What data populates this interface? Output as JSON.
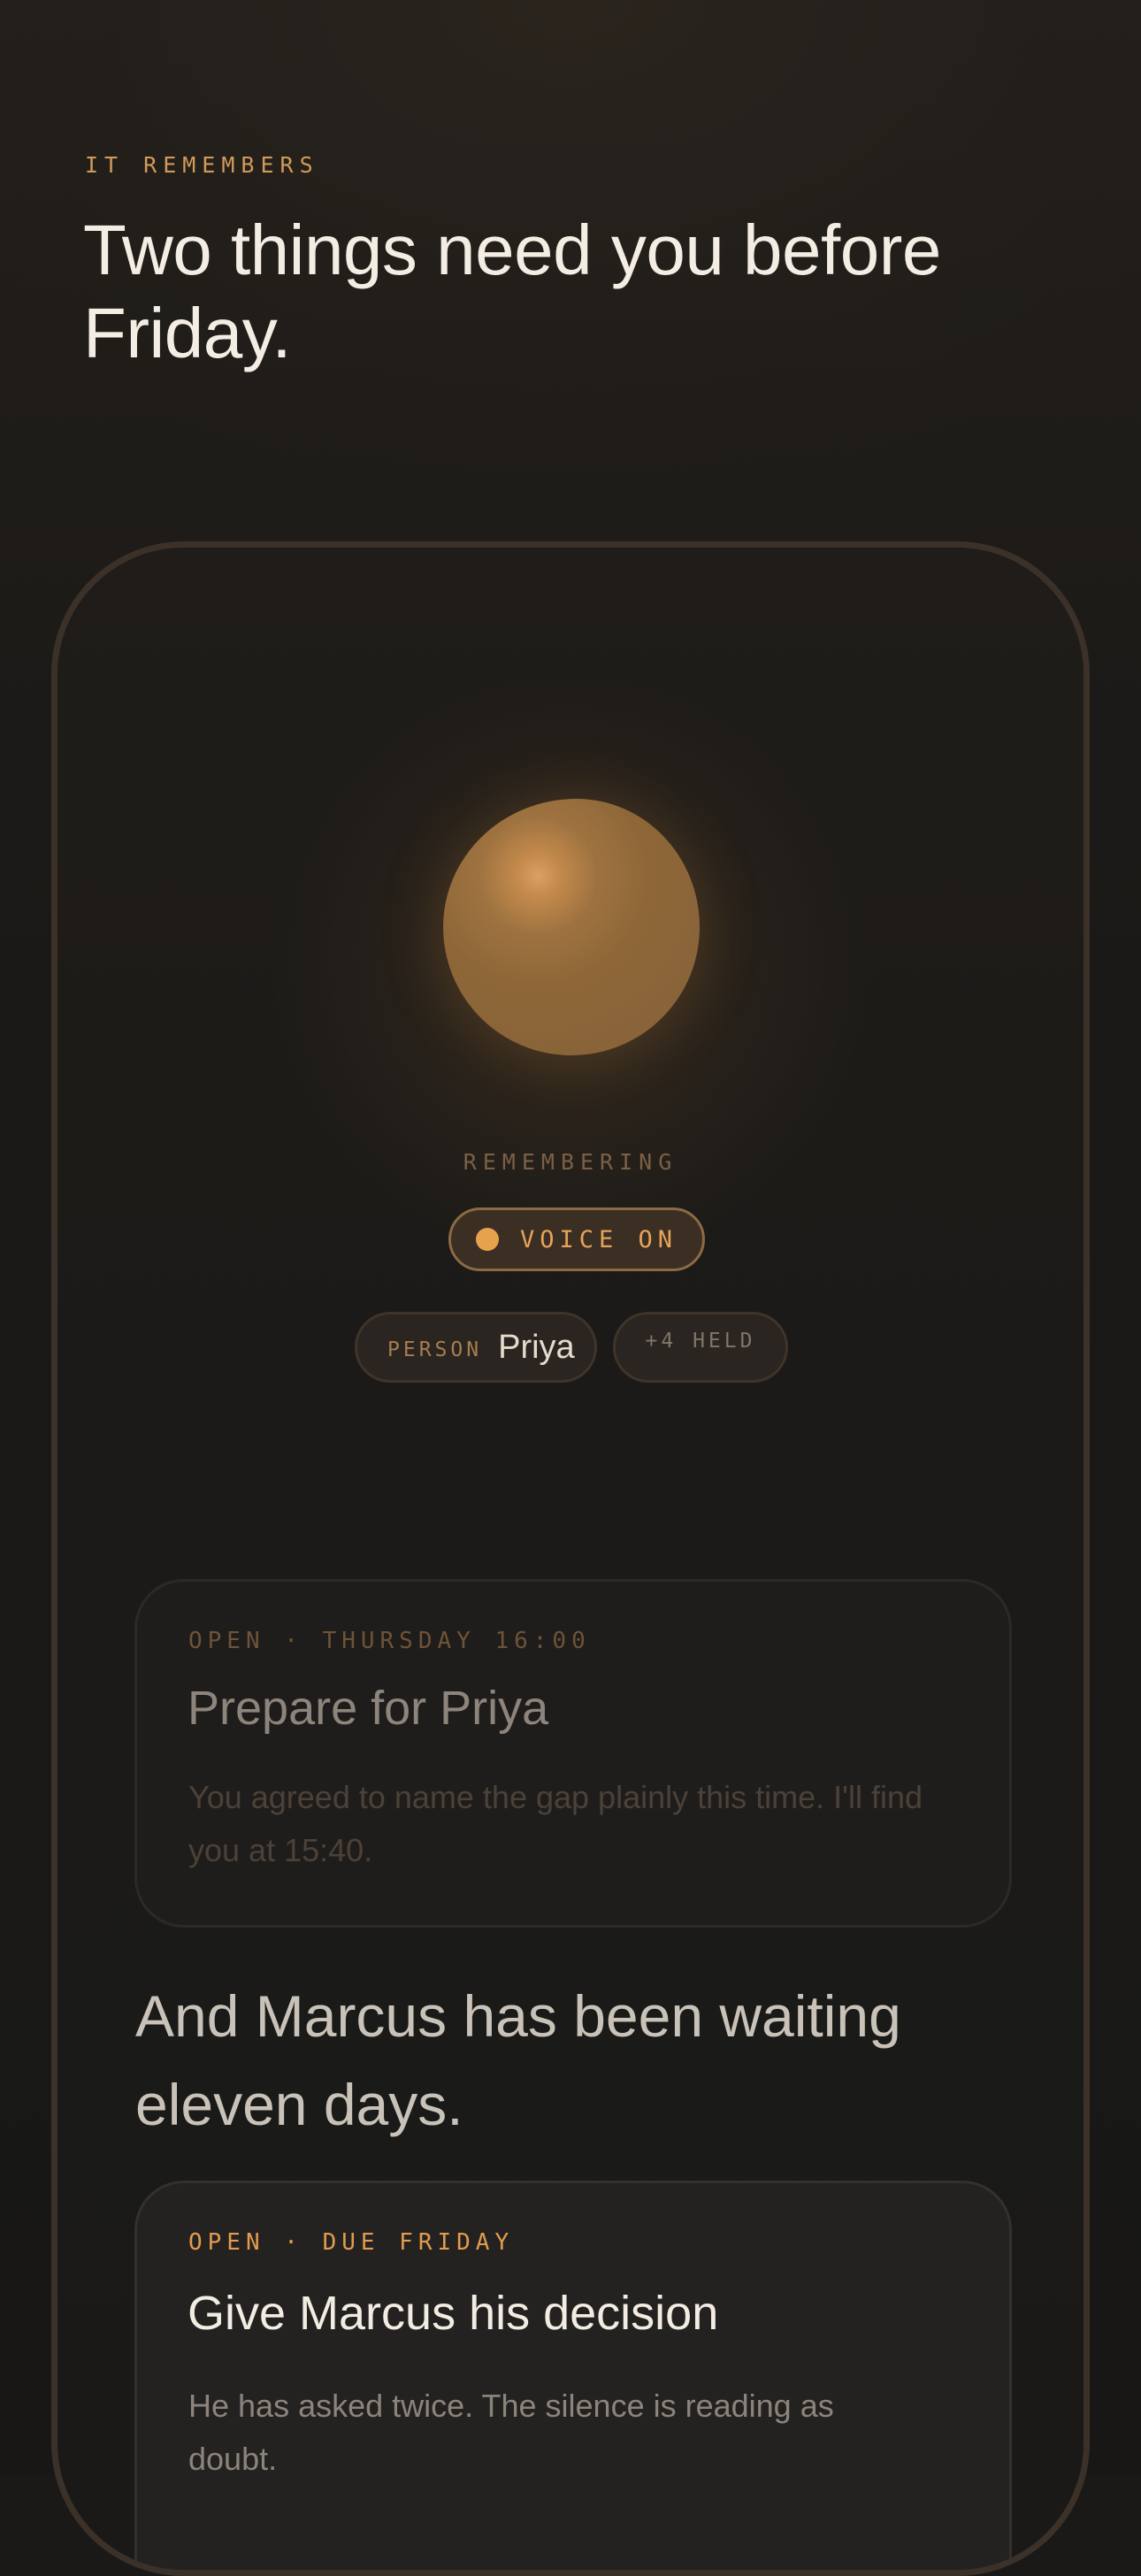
{
  "header": {
    "eyebrow": "IT REMEMBERS",
    "headline": "Two things need you before Friday."
  },
  "assistant": {
    "status": "REMEMBERING",
    "voice_toggle": {
      "label": "VOICE ON",
      "state": "on"
    },
    "context_chips": [
      {
        "kind": "PERSON",
        "value": "Priya"
      },
      {
        "label": "+4 HELD"
      }
    ]
  },
  "tasks": [
    {
      "tag": "OPEN · THURSDAY 16:00",
      "title": "Prepare for Priya",
      "body": "You agreed to name the gap plainly this time. I'll find you at 15:40."
    },
    {
      "tag": "OPEN · DUE FRIDAY",
      "title": "Give Marcus his decision",
      "body": "He has asked twice. The silence is reading as doubt."
    }
  ],
  "interlude": "And Marcus has been waiting eleven days.",
  "colors": {
    "accent": "#e29b4f",
    "orb": "#8e6738",
    "background": "#1a1917",
    "text": "#f3ede4"
  }
}
